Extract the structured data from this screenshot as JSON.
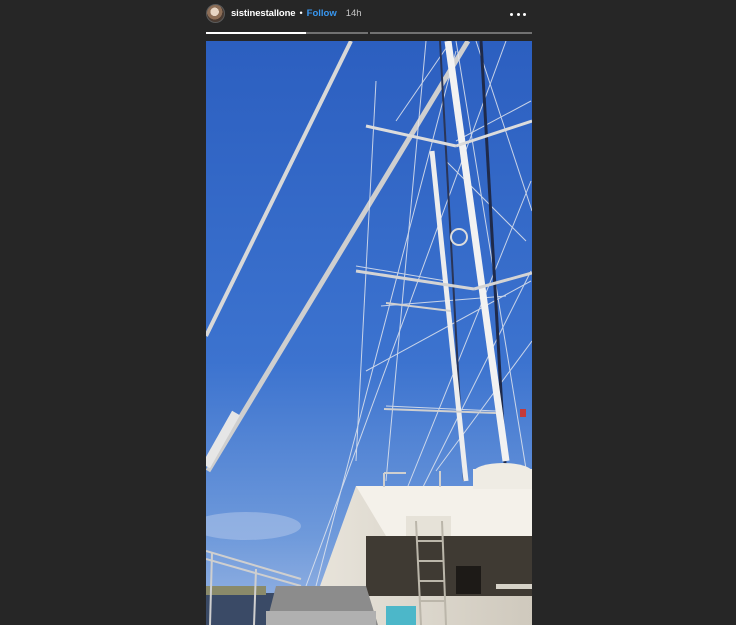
{
  "story": {
    "username": "sistinestallone",
    "separator": "•",
    "follow_label": "Follow",
    "timestamp": "14h",
    "segments": [
      {
        "progress": 1.0
      },
      {
        "progress": 0.0
      }
    ],
    "current_segment_progress": 0.62
  },
  "icons": {
    "more": "more-horizontal-icon",
    "avatar": "profile-avatar"
  },
  "colors": {
    "background": "#262626",
    "follow_link": "#3897f0",
    "sky_top": "#2f63c2",
    "sky_bottom": "#6f96d6"
  }
}
